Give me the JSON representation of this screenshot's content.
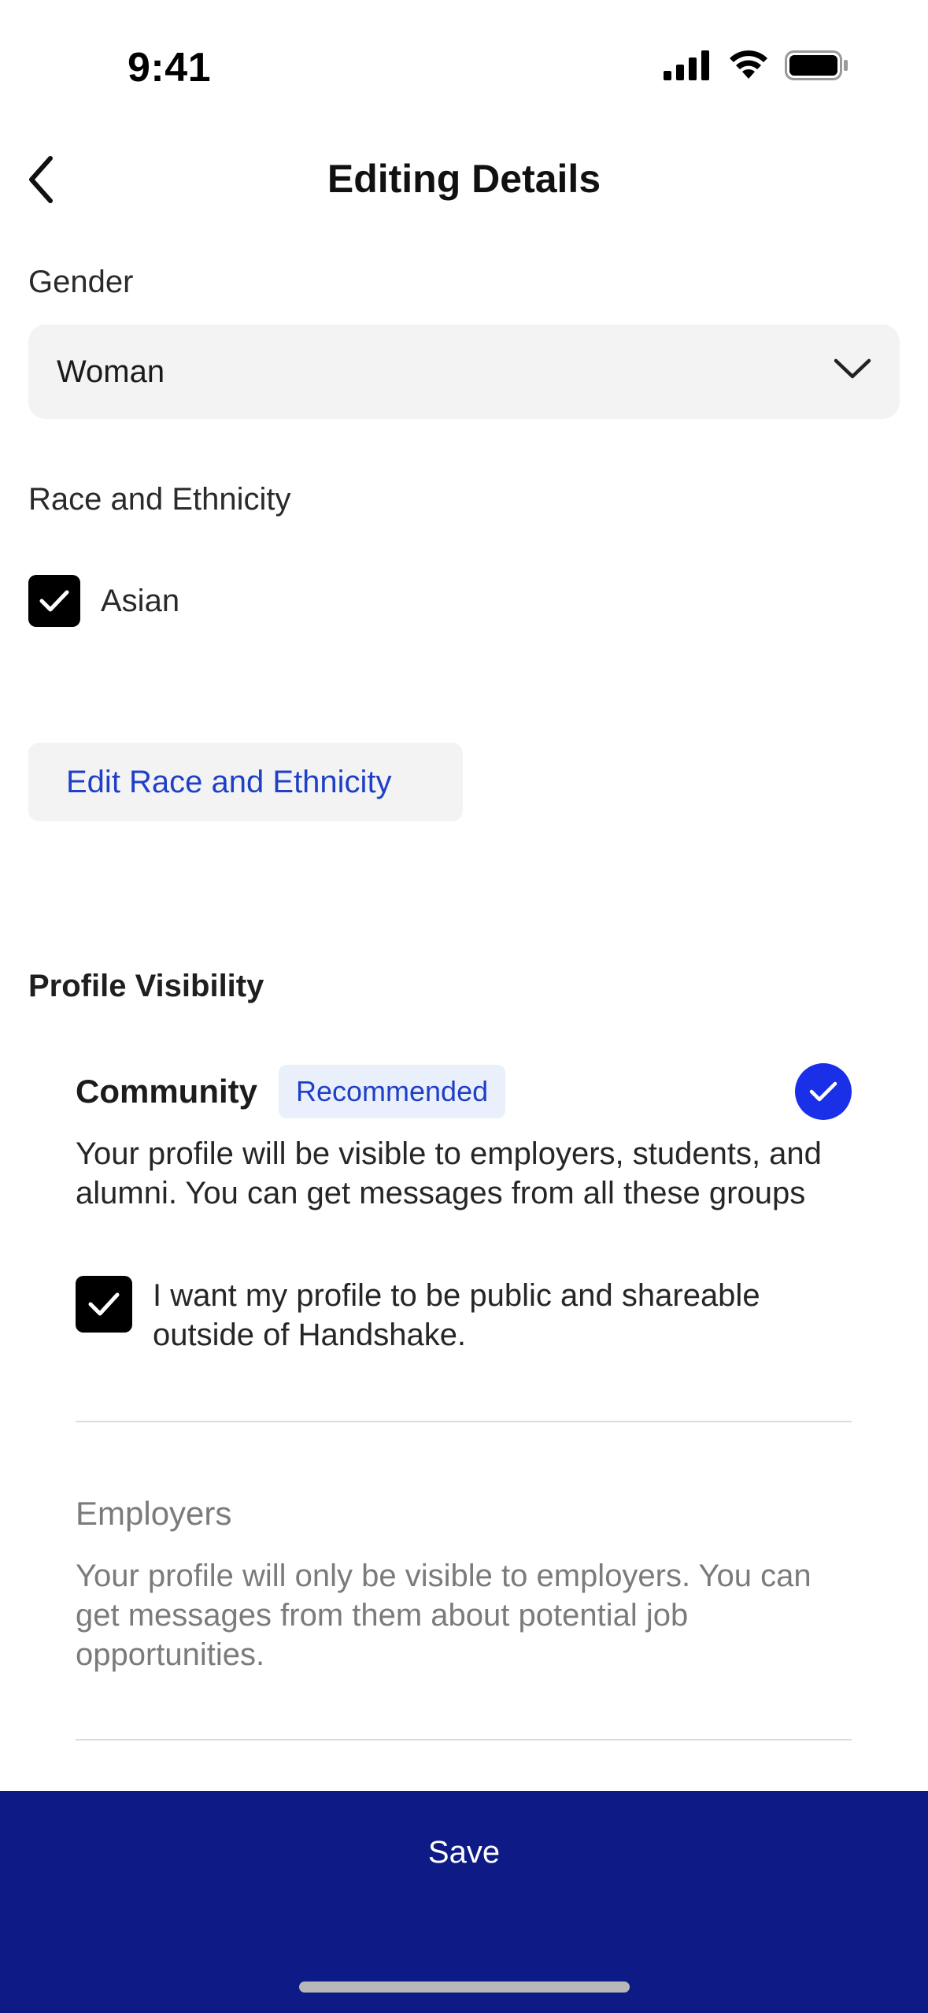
{
  "status_bar": {
    "time": "9:41"
  },
  "header": {
    "title": "Editing Details"
  },
  "gender": {
    "label": "Gender",
    "value": "Woman"
  },
  "race": {
    "label": "Race and Ethnicity",
    "selected": [
      {
        "label": "Asian",
        "checked": true
      }
    ],
    "edit_button": "Edit Race and Ethnicity"
  },
  "visibility": {
    "label": "Profile Visibility",
    "options": [
      {
        "title": "Community",
        "badge": "Recommended",
        "selected": true,
        "description": "Your profile will be visible to employers, students, and alumni. You can get messages from all these groups",
        "public_checkbox": {
          "label": "I want my profile to be public and shareable outside of Handshake.",
          "checked": true
        }
      },
      {
        "title": "Employers",
        "selected": false,
        "description": "Your profile will only be visible to employers. You can get messages from them about potential job opportunities."
      }
    ]
  },
  "footer": {
    "save_label": "Save"
  },
  "colors": {
    "accent": "#1a2fe8",
    "link": "#1f3fc7",
    "save_bar": "#0e1a86"
  },
  "icons": [
    "back-chevron-icon",
    "chevron-down-icon",
    "checkmark-icon",
    "signal-icon",
    "wifi-icon",
    "battery-icon"
  ]
}
